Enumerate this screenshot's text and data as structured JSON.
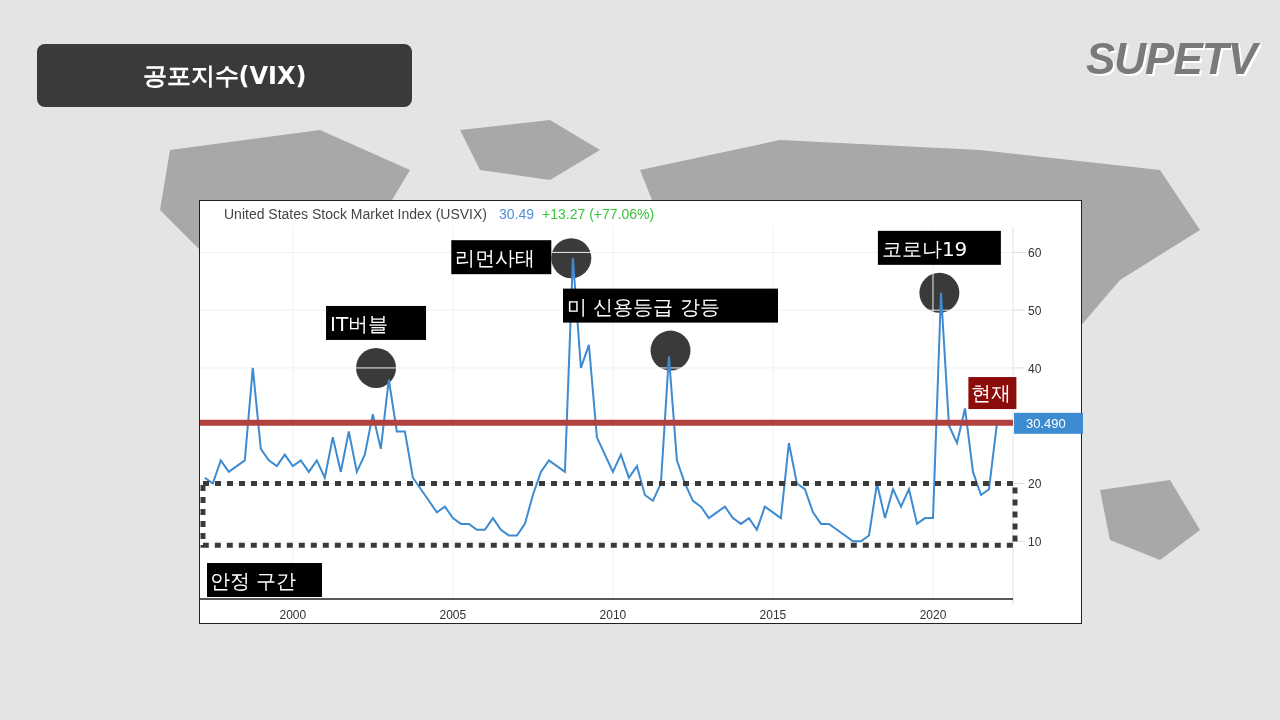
{
  "slide_title": "공포지수(VIX)",
  "logo": "SUPETV",
  "chart_panel": {
    "title": "United States Stock Market Index (USVIX)",
    "last_value": "30.49",
    "change": "+13.27 (+77.06%)",
    "last_value_tag": "30.490",
    "chart_data": {
      "type": "line",
      "x": [
        1997.25,
        1997.5,
        1997.75,
        1998,
        1998.25,
        1998.5,
        1998.75,
        1999,
        1999.25,
        1999.5,
        1999.75,
        2000,
        2000.25,
        2000.5,
        2000.75,
        2001,
        2001.25,
        2001.5,
        2001.75,
        2002,
        2002.25,
        2002.5,
        2002.75,
        2003,
        2003.25,
        2003.5,
        2003.75,
        2004,
        2004.25,
        2004.5,
        2004.75,
        2005,
        2005.25,
        2005.5,
        2005.75,
        2006,
        2006.25,
        2006.5,
        2006.75,
        2007,
        2007.25,
        2007.5,
        2007.75,
        2008,
        2008.25,
        2008.5,
        2008.75,
        2009,
        2009.25,
        2009.5,
        2009.75,
        2010,
        2010.25,
        2010.5,
        2010.75,
        2011,
        2011.25,
        2011.5,
        2011.75,
        2012,
        2012.25,
        2012.5,
        2012.75,
        2013,
        2013.25,
        2013.5,
        2013.75,
        2014,
        2014.25,
        2014.5,
        2014.75,
        2015,
        2015.25,
        2015.5,
        2015.75,
        2016,
        2016.25,
        2016.5,
        2016.75,
        2017,
        2017.25,
        2017.5,
        2017.75,
        2018,
        2018.25,
        2018.5,
        2018.75,
        2019,
        2019.25,
        2019.5,
        2019.75,
        2020,
        2020.25,
        2020.5,
        2020.75,
        2021,
        2021.25,
        2021.5,
        2021.75,
        2022
      ],
      "series": [
        {
          "color": "#3d8bd0",
          "values": [
            21,
            20,
            24,
            22,
            23,
            24,
            40,
            26,
            24,
            23,
            25,
            23,
            24,
            22,
            24,
            21,
            28,
            22,
            29,
            22,
            25,
            32,
            26,
            38,
            29,
            29,
            21,
            19,
            17,
            15,
            16,
            14,
            13,
            13,
            12,
            12,
            14,
            12,
            11,
            11,
            13,
            18,
            22,
            24,
            23,
            22,
            59,
            40,
            44,
            28,
            25,
            22,
            25,
            21,
            23,
            18,
            17,
            20,
            42,
            24,
            20,
            17,
            16,
            14,
            15,
            16,
            14,
            13,
            14,
            12,
            16,
            15,
            14,
            27,
            20,
            19,
            15,
            13,
            13,
            12,
            11,
            10,
            10,
            11,
            20,
            14,
            19,
            16,
            19,
            13,
            14,
            14,
            53,
            30,
            27,
            33,
            22,
            18,
            19,
            30.5
          ]
        }
      ],
      "yticks": [
        10,
        20,
        40,
        50,
        60
      ],
      "xticks": [
        2000,
        2005,
        2010,
        2015,
        2020
      ],
      "xlim": [
        1997.1,
        2022.5
      ],
      "ylim": [
        0,
        64.4
      ],
      "grid": true
    },
    "events": [
      {
        "kind": "peak",
        "label": "IT버블"
      },
      {
        "kind": "peak",
        "label": "리먼사태"
      },
      {
        "kind": "peak",
        "label": "미 신용등급 강등"
      },
      {
        "kind": "peak",
        "label": "코로나19"
      },
      {
        "kind": "current",
        "label": "현재"
      },
      {
        "kind": "band",
        "label": "안정 구간"
      }
    ]
  }
}
